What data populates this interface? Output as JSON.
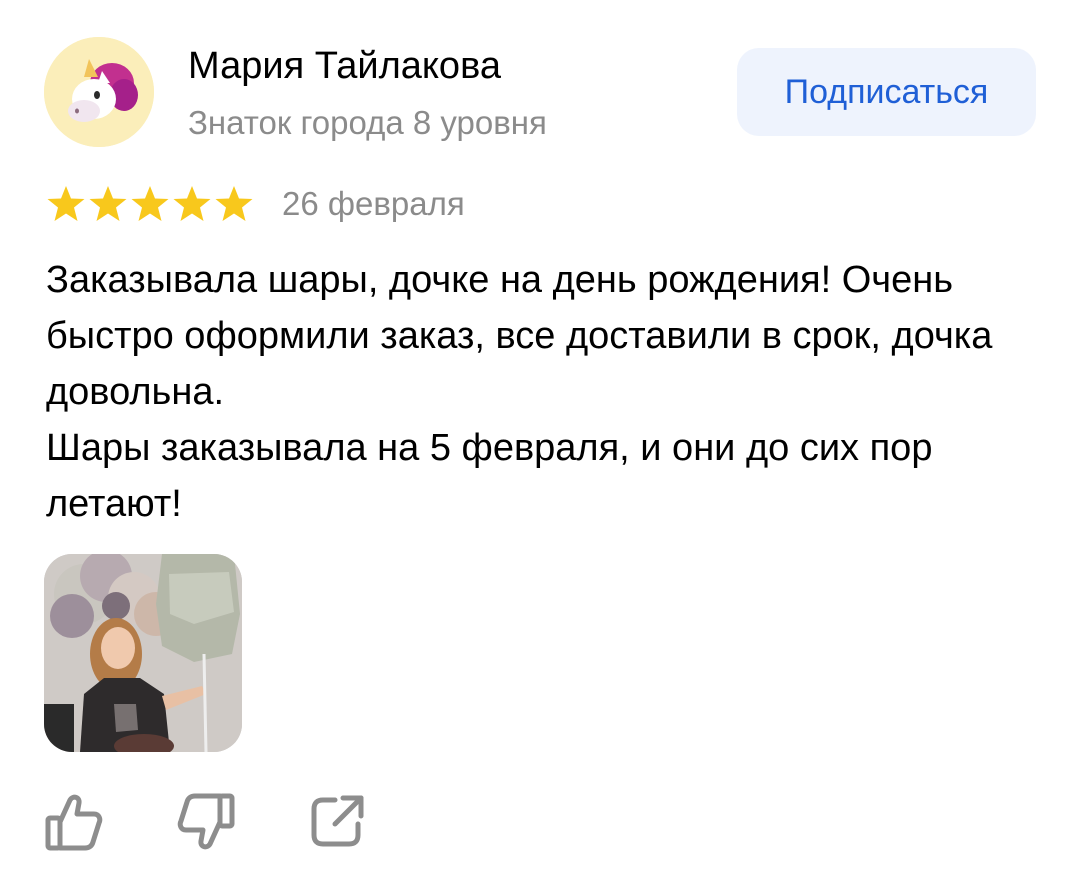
{
  "author": {
    "name": "Мария Тайлакова",
    "level": "Знаток города 8 уровня",
    "avatar_icon": "unicorn-icon"
  },
  "subscribe": {
    "label": "Подписаться",
    "color": "#1f5fd6",
    "background": "#eef3fd"
  },
  "rating": {
    "stars": 5,
    "max": 5,
    "star_color": "#f8c81c"
  },
  "review": {
    "date": "26 февраля",
    "paragraphs": [
      "Заказывала шары, дочке на день рождения! Очень быстро оформили заказ, все доставили в срок, дочка довольна.",
      "Шары заказывала на 5 февраля, и они до сих пор летают!"
    ]
  },
  "photos": [
    {
      "icon": "review-photo"
    }
  ],
  "actions": {
    "like_icon": "thumbs-up-icon",
    "dislike_icon": "thumbs-down-icon",
    "share_icon": "share-icon"
  }
}
